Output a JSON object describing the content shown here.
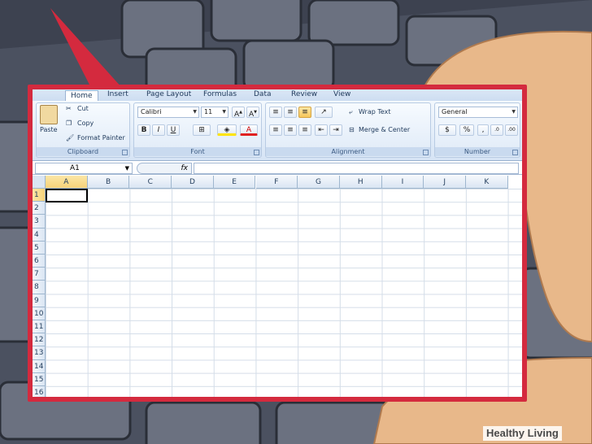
{
  "ribbon": {
    "tabs": [
      "Home",
      "Insert",
      "Page Layout",
      "Formulas",
      "Data",
      "Review",
      "View"
    ],
    "clipboard": {
      "label": "Clipboard",
      "paste": "Paste",
      "cut": "Cut",
      "copy": "Copy",
      "format_painter": "Format Painter"
    },
    "font": {
      "label": "Font",
      "name": "Calibri",
      "size": "11"
    },
    "alignment": {
      "label": "Alignment",
      "wrap_text": "Wrap Text",
      "merge_center": "Merge & Center"
    },
    "number": {
      "label": "Number",
      "format": "General"
    }
  },
  "formula_bar": {
    "name_box": "A1",
    "fx": "fx",
    "value": ""
  },
  "grid": {
    "columns": [
      "A",
      "B",
      "C",
      "D",
      "E",
      "F",
      "G",
      "H",
      "I",
      "J",
      "K"
    ],
    "rows": [
      "1",
      "2",
      "3",
      "4",
      "5",
      "6",
      "7",
      "8",
      "9",
      "10",
      "11",
      "12",
      "13",
      "14",
      "15",
      "16"
    ],
    "selected_cell": "A1"
  },
  "watermark": "Healthy Living"
}
